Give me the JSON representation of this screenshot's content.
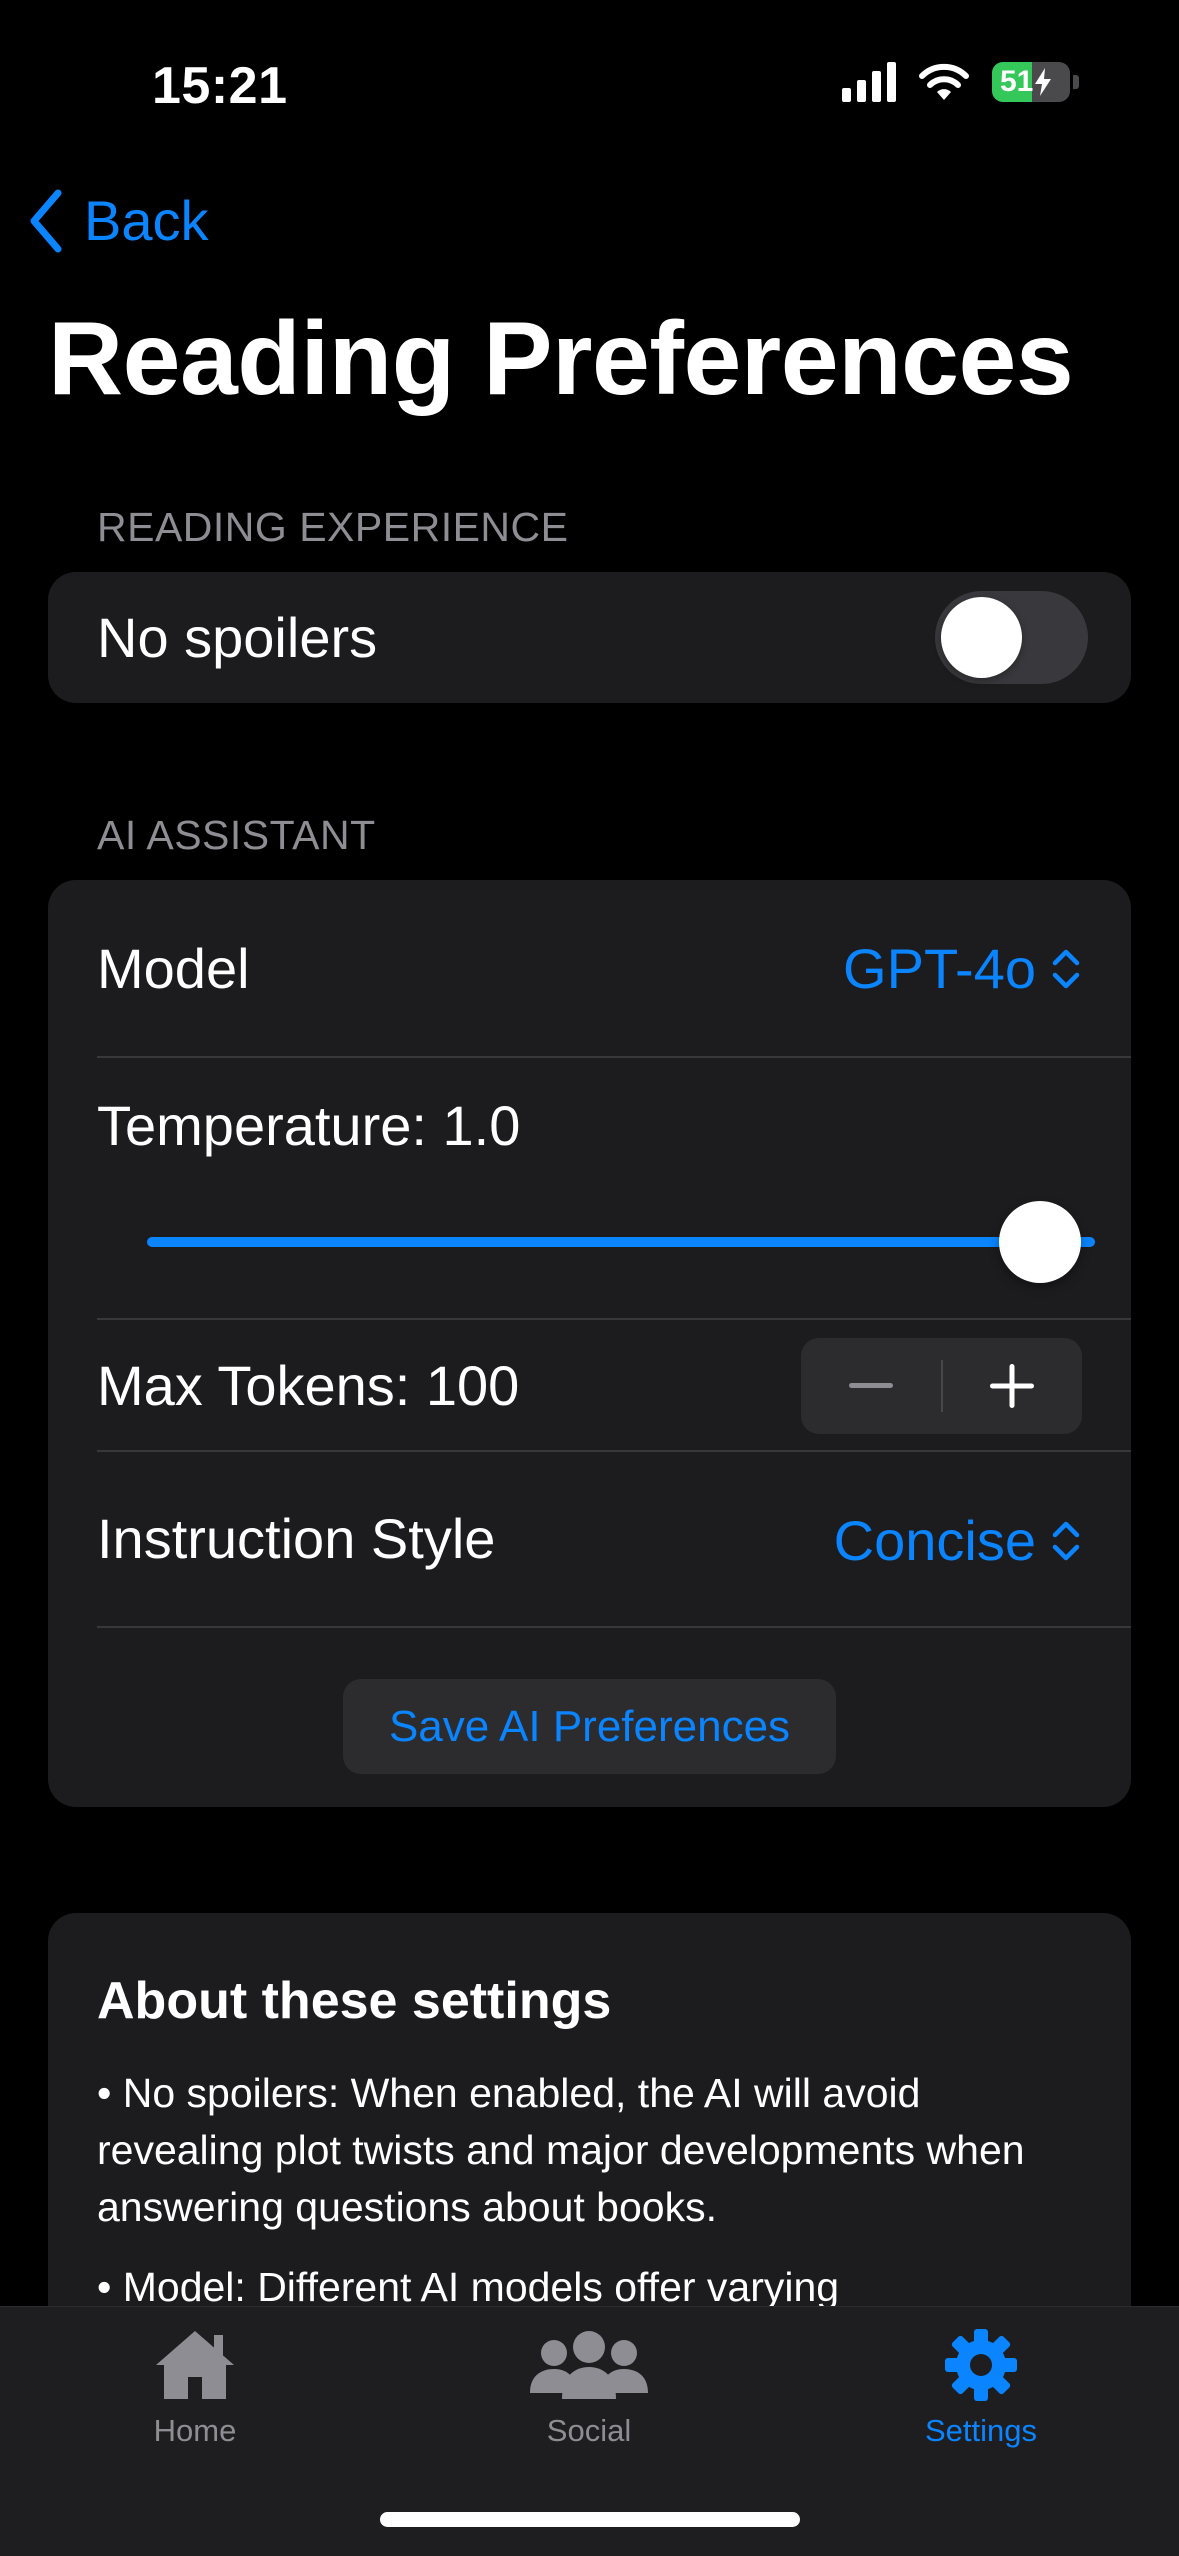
{
  "status_bar": {
    "time": "15:21",
    "battery_percent": "51"
  },
  "nav": {
    "back_label": "Back"
  },
  "page_title": "Reading Preferences",
  "reading_experience": {
    "header": "READING EXPERIENCE",
    "no_spoilers_label": "No spoilers",
    "no_spoilers_enabled": false
  },
  "ai_assistant": {
    "header": "AI ASSISTANT",
    "model_label": "Model",
    "model_value": "GPT-4o",
    "temperature_label": "Temperature: 1.0",
    "temperature_value": 1.0,
    "max_tokens_label": "Max Tokens: 100",
    "instruction_style_label": "Instruction Style",
    "instruction_style_value": "Concise",
    "save_button_label": "Save AI Preferences"
  },
  "about": {
    "title": "About these settings",
    "paragraph_1": "• No spoilers: When enabled, the AI will avoid revealing plot twists and major developments when answering questions about books.",
    "paragraph_2": "• Model: Different AI models offer varying"
  },
  "tab_bar": {
    "home_label": "Home",
    "social_label": "Social",
    "settings_label": "Settings",
    "active_tab": "Settings"
  },
  "colors": {
    "accent": "#0a84ff",
    "background": "#000000",
    "card": "#1c1c1e",
    "secondary_text": "#8d8d93",
    "battery_green": "#34c759"
  }
}
